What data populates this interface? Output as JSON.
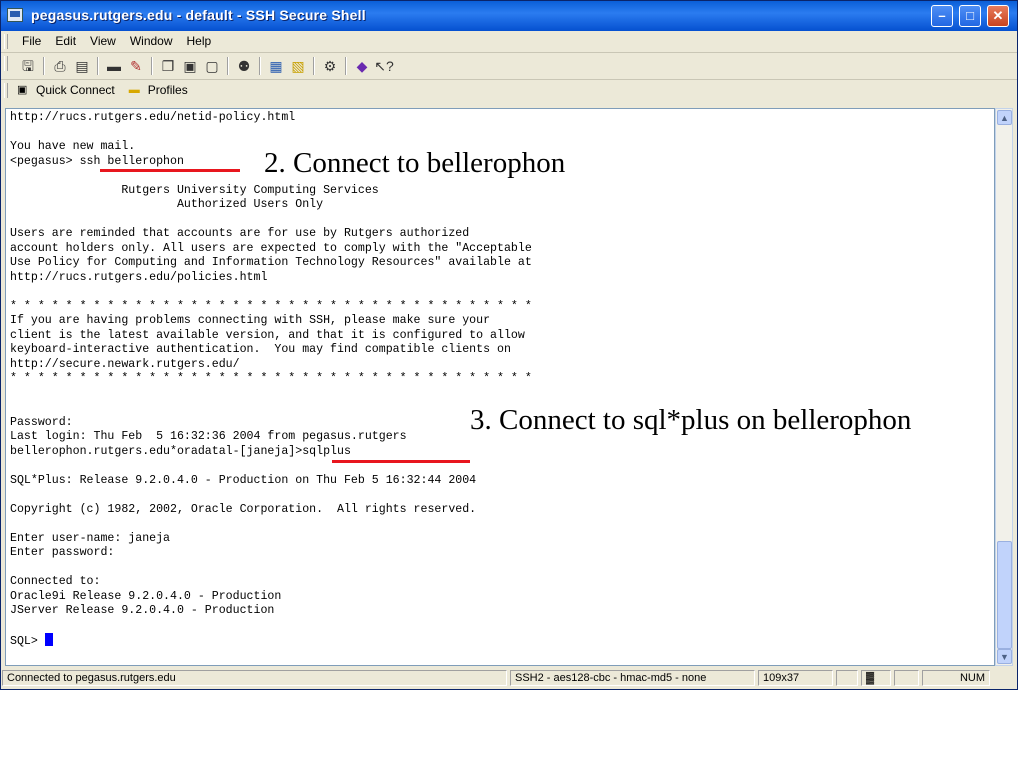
{
  "window": {
    "title": "pegasus.rutgers.edu - default - SSH Secure Shell",
    "controls": {
      "minimize": "–",
      "maximize": "□",
      "close": "✕"
    }
  },
  "menu": [
    "File",
    "Edit",
    "View",
    "Window",
    "Help"
  ],
  "toolbar_icons": [
    "save-icon",
    "print-icon",
    "print-preview-icon",
    "disconnect-icon",
    "settings-icon",
    "copy-icon",
    "paste-icon",
    "paste-special-icon",
    "find-icon",
    "new-terminal-icon",
    "new-file-transfer-icon",
    "settings-gear-icon",
    "profile-icon",
    "help-icon"
  ],
  "quick_bar": {
    "quick_connect": "Quick Connect",
    "profiles": "Profiles"
  },
  "terminal": {
    "lines": [
      "http://rucs.rutgers.edu/netid-policy.html",
      "",
      "You have new mail.",
      "<pegasus> ssh bellerophon",
      "",
      "                Rutgers University Computing Services",
      "                        Authorized Users Only",
      "",
      "Users are reminded that accounts are for use by Rutgers authorized",
      "account holders only. All users are expected to comply with the \"Acceptable",
      "Use Policy for Computing and Information Technology Resources\" available at",
      "http://rucs.rutgers.edu/policies.html",
      "",
      "* * * * * * * * * * * * * * * * * * * * * * * * * * * * * * * * * * * * * *",
      "If you are having problems connecting with SSH, please make sure your",
      "client is the latest available version, and that it is configured to allow",
      "keyboard-interactive authentication.  You may find compatible clients on",
      "http://secure.newark.rutgers.edu/",
      "* * * * * * * * * * * * * * * * * * * * * * * * * * * * * * * * * * * * * *",
      "",
      "",
      "Password:",
      "Last login: Thu Feb  5 16:32:36 2004 from pegasus.rutgers",
      "bellerophon.rutgers.edu*oradatal-[janeja]>sqlplus",
      "",
      "SQL*Plus: Release 9.2.0.4.0 - Production on Thu Feb 5 16:32:44 2004",
      "",
      "Copyright (c) 1982, 2002, Oracle Corporation.  All rights reserved.",
      "",
      "Enter user-name: janeja",
      "Enter password:",
      "",
      "Connected to:",
      "Oracle9i Release 9.2.0.4.0 - Production",
      "JServer Release 9.2.0.4.0 - Production",
      "",
      "SQL> "
    ]
  },
  "status": {
    "connection": "Connected to pegasus.rutgers.edu",
    "cipher": "SSH2 - aes128-cbc - hmac-md5 - none",
    "size": "109x37",
    "num": "NUM"
  },
  "annotations": {
    "step2": "2. Connect to bellerophon",
    "step3": "3. Connect to sql*plus on bellerophon"
  },
  "colors": {
    "underline": "#e8161e",
    "cursor": "#0000ff",
    "titlebar": "#0a5fd8"
  }
}
